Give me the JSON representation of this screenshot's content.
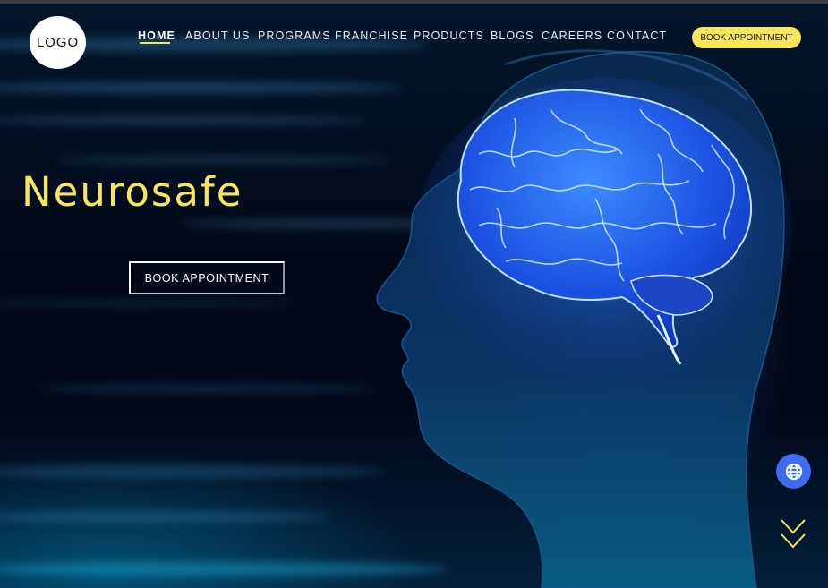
{
  "header": {
    "logo_text": "LOGO",
    "nav": [
      {
        "label": "HOME",
        "active": true
      },
      {
        "label": "ABOUT US"
      },
      {
        "label": "PROGRAMS"
      },
      {
        "label": "FRANCHISE"
      },
      {
        "label": "PRODUCTS"
      },
      {
        "label": "BLOGS"
      },
      {
        "label": "CAREERS"
      },
      {
        "label": "CONTACT"
      }
    ],
    "cta_label": "BOOK APPOINTMENT"
  },
  "hero": {
    "title": "Neurosafe",
    "cta_label": "BOOK APPOINTMENT"
  },
  "floating": {
    "language_icon": "globe-icon",
    "scroll_icon": "double-chevron-down-icon"
  },
  "colors": {
    "accent_yellow": "#f7e55c",
    "button_blue": "#3f6bf0",
    "background": "#020716",
    "brain_blue": "#1f5dff"
  }
}
